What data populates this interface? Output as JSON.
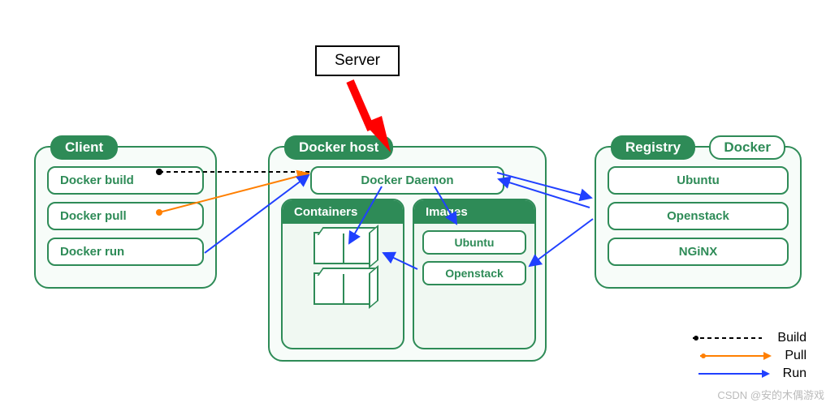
{
  "annotation": {
    "label": "Server"
  },
  "client": {
    "title": "Client",
    "commands": [
      "Docker build",
      "Docker pull",
      "Docker run"
    ]
  },
  "host": {
    "title": "Docker host",
    "daemon": "Docker Daemon",
    "containers_title": "Containers",
    "images_title": "Images",
    "images": [
      "Ubuntu",
      "Openstack"
    ]
  },
  "registry": {
    "title": "Registry",
    "badge": "Docker",
    "items": [
      "Ubuntu",
      "Openstack",
      "NGiNX"
    ]
  },
  "legend": {
    "build": "Build",
    "pull": "Pull",
    "run": "Run"
  },
  "watermark": "CSDN @安的木偶游戏"
}
